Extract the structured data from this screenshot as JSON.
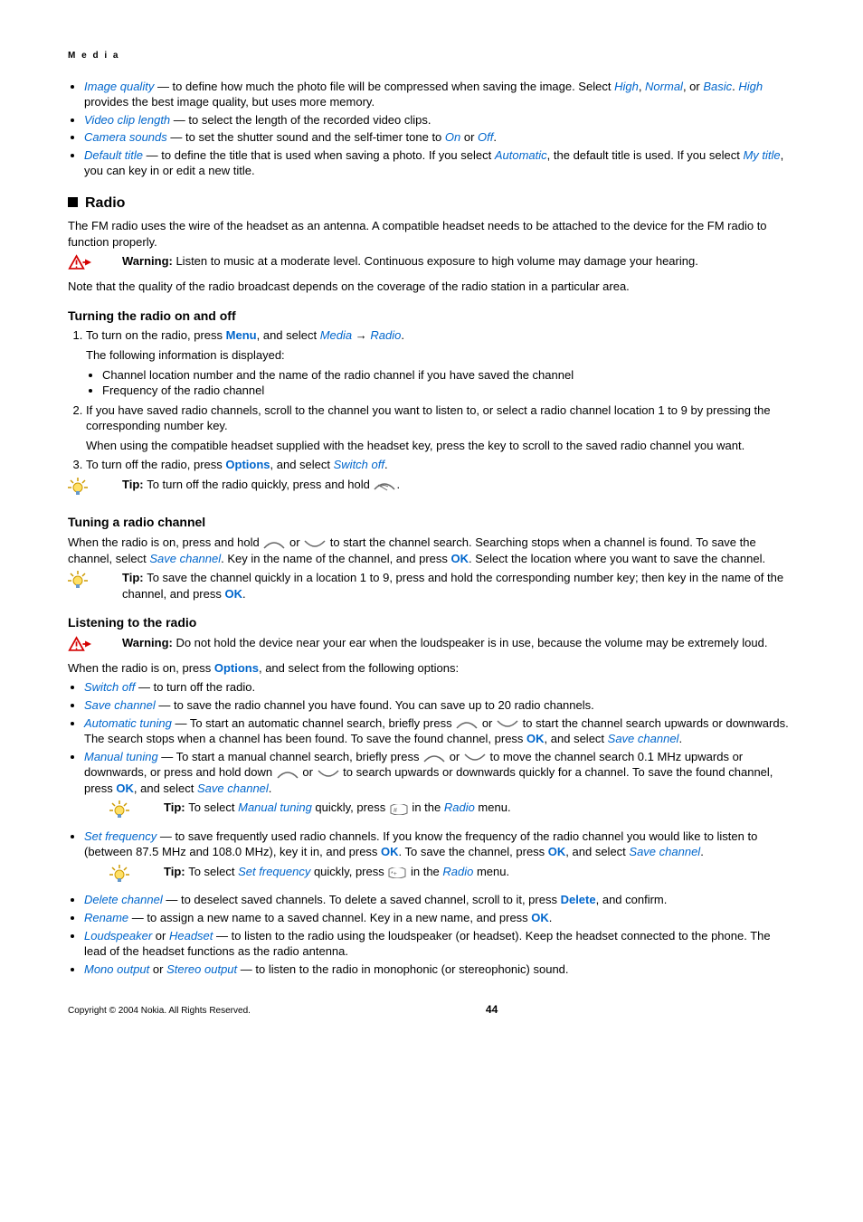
{
  "breadcrumb": "M e d i a",
  "cameraList": {
    "imageQuality": {
      "term": "Image quality",
      "text1": " — to define how much the photo file will be compressed when saving the image. Select ",
      "opt1": "High",
      "sep": ", ",
      "opt2": "Normal",
      "sep2": ", or ",
      "opt3": "Basic",
      "text2": ". ",
      "opt4": "High",
      "text3": " provides the best image quality, but uses more memory."
    },
    "videoClip": {
      "term": "Video clip length",
      "text": " — to select the length of the recorded video clips."
    },
    "cameraSounds": {
      "term": "Camera sounds",
      "text1": " — to set the shutter sound and the self-timer tone to ",
      "opt1": "On",
      "sep": " or ",
      "opt2": "Off",
      "text2": "."
    },
    "defaultTitle": {
      "term": "Default title",
      "text1": " — to define the title that is used when saving a photo. If you select ",
      "opt1": "Automatic",
      "text2": ", the default title is used. If you select ",
      "opt2": "My title",
      "text3": ", you can key in or edit a new title."
    }
  },
  "radio": {
    "heading": "Radio",
    "intro": "The FM radio uses the wire of the headset as an antenna. A compatible headset needs to be attached to the device for the FM radio to function properly.",
    "warnLabel": "Warning:  ",
    "warning": "Listen to music at a moderate level. Continuous exposure to high volume may damage your hearing.",
    "note": "Note that the quality of the radio broadcast depends on the coverage of the radio station in a particular area."
  },
  "turning": {
    "heading": "Turning the radio on and off",
    "s1a": "To turn on the radio, press ",
    "menu": "Menu",
    "s1b": ", and select ",
    "media": "Media",
    "arrow": "  →  ",
    "radioItem": "Radio",
    "s1c": ".",
    "disp": "The following information is displayed:",
    "b1": "Channel location number and the name of the radio channel if you have saved the channel",
    "b2": "Frequency of the radio channel",
    "s2": "If you have saved radio channels, scroll to the channel you want to listen to, or select a radio channel location 1 to 9 by pressing the corresponding number key.",
    "s2b": "When using the compatible headset supplied with the headset key, press the key to scroll to the saved radio channel you want.",
    "s3a": "To turn off the radio, press ",
    "options": "Options",
    "s3b": ", and select ",
    "switchOff": "Switch off",
    "s3c": ".",
    "tipLabel": "Tip: ",
    "tip": "To turn off the radio quickly, press and hold "
  },
  "tuning": {
    "heading": "Tuning a radio channel",
    "p1a": "When the radio is on, press and hold ",
    "p1b": " or ",
    "p1c": " to start the channel search. Searching stops when a channel is found. To save the channel, select ",
    "saveCh": "Save channel",
    "p1d": ". Key in the name of the channel, and press ",
    "ok": "OK",
    "p1e": ". Select the location where you want to save the channel.",
    "tipLabel": "Tip: ",
    "tip1": "To save the channel quickly in a location 1 to 9, press and hold the corresponding number key; then key in the name of the channel, and press ",
    "tip2": "."
  },
  "listening": {
    "heading": "Listening to the radio",
    "warnLabel": "Warning:  ",
    "warning": "Do not hold the device near your ear when the loudspeaker is in use, because the volume may be extremely loud.",
    "intro1": "When the radio is on, press ",
    "options": "Options",
    "intro2": ", and select from the following options:",
    "switchOff": {
      "term": "Switch off",
      "text": " — to turn off the radio."
    },
    "saveCh": {
      "term": "Save channel",
      "text": " — to save the radio channel you have found. You can save up to 20 radio channels."
    },
    "auto": {
      "term": "Automatic tuning",
      "t1": " — To start an automatic channel search, briefly press ",
      "t2": " or ",
      "t3": " to start the channel search upwards or downwards. The search stops when a channel has been found. To save the found channel, press ",
      "ok": "OK",
      "t4": ", and select ",
      "save": "Save channel",
      "t5": "."
    },
    "manual": {
      "term": "Manual tuning",
      "t1": " — To start a manual channel search, briefly press ",
      "t2": " or ",
      "t3": " to move the channel search 0.1 MHz upwards or downwards, or press and hold down ",
      "t4": " or ",
      "t5": " to search upwards or downwards quickly for a channel. To save the found channel, press ",
      "ok": "OK",
      "t6": ", and select ",
      "save": "Save channel",
      "t7": "."
    },
    "manualTip": {
      "label": "Tip: ",
      "t1": "To select ",
      "term": "Manual tuning",
      "t2": " quickly, press ",
      "t3": " in the ",
      "radio": "Radio",
      "t4": " menu."
    },
    "setFreq": {
      "term": "Set frequency",
      "t1": " — to save frequently used radio channels. If you know the frequency of the radio channel you would like to listen to (between 87.5 MHz and 108.0 MHz), key it in, and press ",
      "ok": "OK",
      "t2": ". To save the channel, press ",
      "t3": ", and select ",
      "save": "Save channel",
      "t4": "."
    },
    "freqTip": {
      "label": "Tip: ",
      "t1": "To select ",
      "term": "Set frequency",
      "t2": " quickly, press ",
      "t3": " in the ",
      "radio": "Radio",
      "t4": " menu."
    },
    "deleteCh": {
      "term": "Delete channel",
      "t1": " — to deselect saved channels. To delete a saved channel, scroll to it, press ",
      "del": "Delete",
      "t2": ", and confirm."
    },
    "rename": {
      "term": "Rename",
      "t1": " — to assign a new name to a saved channel. Key in a new name, and press ",
      "ok": "OK",
      "t2": "."
    },
    "loud": {
      "term1": "Loudspeaker",
      "or": " or ",
      "term2": "Headset",
      "t1": " — to listen to the radio using the loudspeaker (or headset). Keep the headset connected to the phone. The lead of the headset functions as the radio antenna."
    },
    "mono": {
      "term1": "Mono output",
      "or": " or ",
      "term2": "Stereo output",
      "t1": " — to listen to the radio in monophonic (or stereophonic) sound."
    }
  },
  "footer": {
    "copyright": "Copyright © 2004 Nokia. All Rights Reserved.",
    "page": "44"
  }
}
